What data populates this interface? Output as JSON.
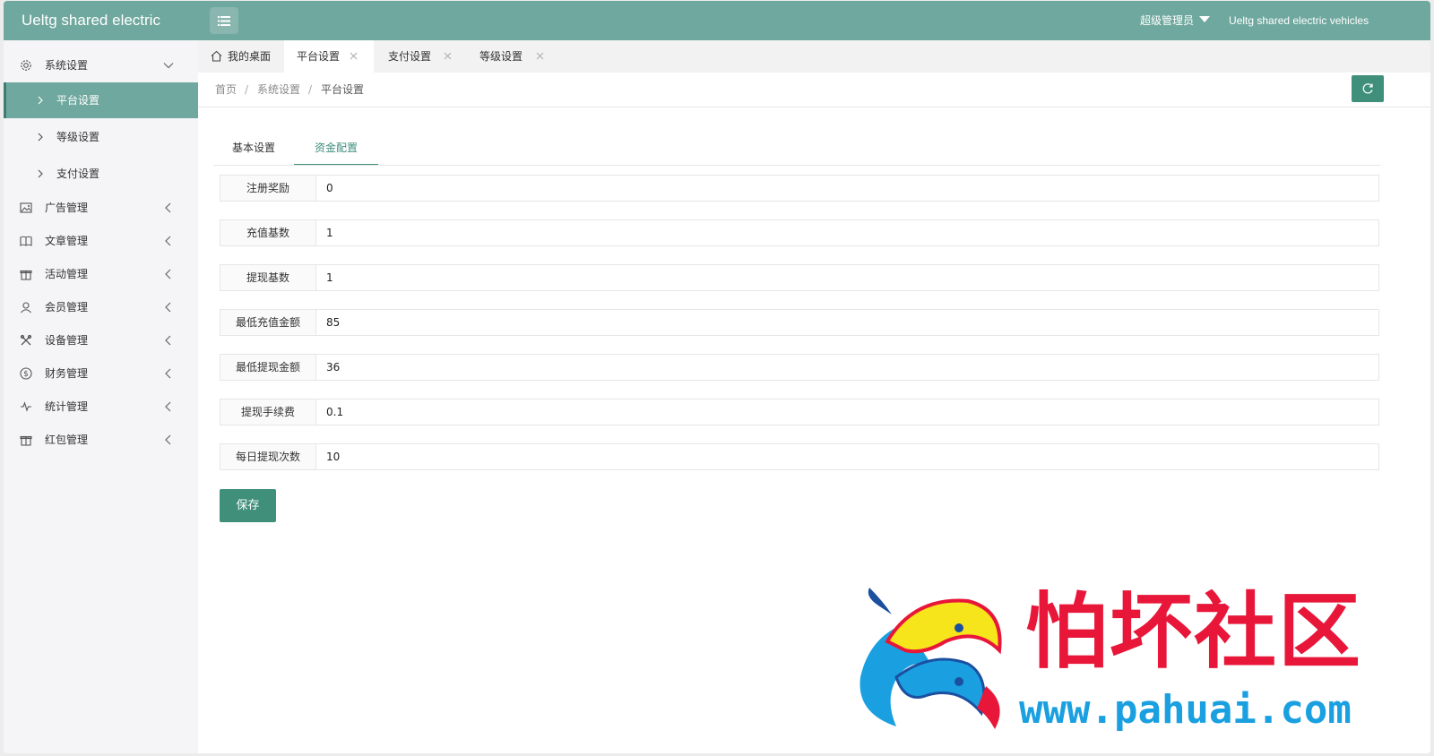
{
  "header": {
    "brand": "Ueltg shared electric",
    "user_label": "超级管理员",
    "site_name": "Ueltg shared electric vehicles"
  },
  "sidebar": {
    "groups": [
      {
        "label": "系统设置",
        "icon": "gear-icon",
        "expanded": true,
        "children": [
          {
            "label": "平台设置",
            "active": true
          },
          {
            "label": "等级设置",
            "active": false
          },
          {
            "label": "支付设置",
            "active": false
          }
        ]
      },
      {
        "label": "广告管理",
        "icon": "image-icon"
      },
      {
        "label": "文章管理",
        "icon": "book-icon"
      },
      {
        "label": "活动管理",
        "icon": "gift-icon"
      },
      {
        "label": "会员管理",
        "icon": "user-icon"
      },
      {
        "label": "设备管理",
        "icon": "tools-icon"
      },
      {
        "label": "财务管理",
        "icon": "dollar-icon"
      },
      {
        "label": "统计管理",
        "icon": "pulse-icon"
      },
      {
        "label": "红包管理",
        "icon": "gift-icon"
      }
    ]
  },
  "tabs": [
    {
      "label": "我的桌面",
      "icon": "home-icon",
      "closable": false,
      "active": false
    },
    {
      "label": "平台设置",
      "closable": true,
      "active": true
    },
    {
      "label": "支付设置",
      "closable": true,
      "active": false
    },
    {
      "label": "等级设置",
      "closable": true,
      "active": false
    }
  ],
  "breadcrumb": [
    "首页",
    "系统设置",
    "平台设置"
  ],
  "content_tabs": [
    {
      "label": "基本设置",
      "active": false
    },
    {
      "label": "资金配置",
      "active": true
    }
  ],
  "form": {
    "fields": [
      {
        "label": "注册奖励",
        "value": "0"
      },
      {
        "label": "充值基数",
        "value": "1"
      },
      {
        "label": "提现基数",
        "value": "1"
      },
      {
        "label": "最低充值金额",
        "value": "85"
      },
      {
        "label": "最低提现金额",
        "value": "36"
      },
      {
        "label": "提现手续费",
        "value": "0.1"
      },
      {
        "label": "每日提现次数",
        "value": "10"
      }
    ],
    "save_label": "保存"
  },
  "watermark": {
    "title": "怕坏社区",
    "url": "www.pahuai.com"
  },
  "colors": {
    "header_bg": "#6fa89e",
    "primary": "#3f8f7b",
    "watermark_red": "#e8173a",
    "watermark_blue": "#1aa0e0"
  }
}
